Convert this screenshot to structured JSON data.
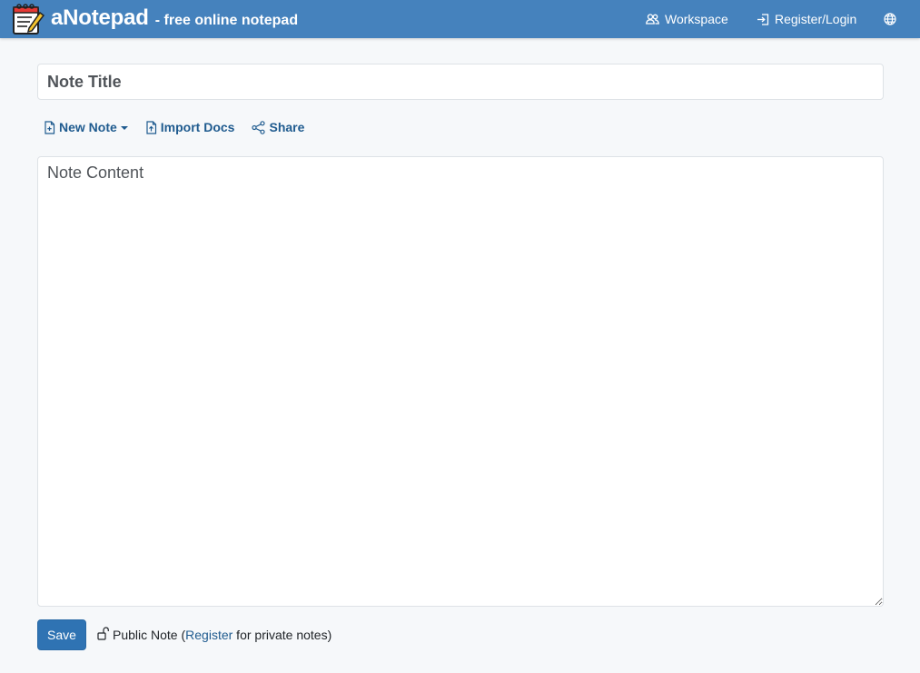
{
  "header": {
    "brand_name": "aNotepad",
    "brand_tagline": "- free online notepad",
    "workspace_label": "Workspace",
    "login_label": "Register/Login",
    "icons": [
      "notepad-logo-icon",
      "people-icon",
      "login-icon",
      "globe-icon"
    ]
  },
  "editor": {
    "title_placeholder": "Note Title",
    "content_placeholder": "Note Content"
  },
  "toolbar": {
    "new_note_label": "New Note",
    "import_label": "Import Docs",
    "share_label": "Share",
    "icons": [
      "file-plus-icon",
      "file-upload-icon",
      "share-icon",
      "caret-down-icon"
    ]
  },
  "footer": {
    "save_label": "Save",
    "public_note_label": "Public Note (",
    "register_link": "Register",
    "private_suffix": " for private notes)",
    "icons": [
      "unlock-icon"
    ]
  },
  "colors": {
    "navbar": "#4582bd",
    "link": "#1f5b8f",
    "save_button": "#2f73b3",
    "page_bg": "#f6f8fa"
  }
}
